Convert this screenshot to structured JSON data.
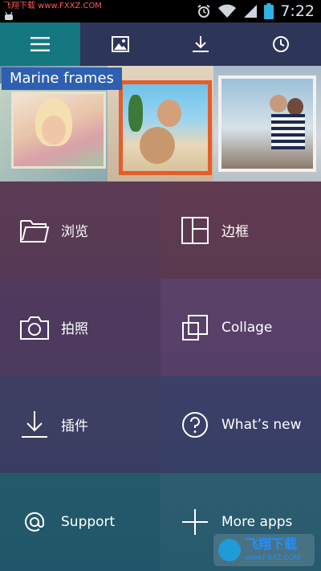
{
  "status_bar": {
    "watermark_text": "飞翔下载 www.FXXZ.COM",
    "time": "7:22",
    "icons": [
      "android-bug-icon",
      "alarm-clock-icon",
      "wifi-icon",
      "signal-icon",
      "battery-icon"
    ]
  },
  "tabs": [
    {
      "icon": "menu-icon",
      "active": true
    },
    {
      "icon": "image-icon",
      "active": false
    },
    {
      "icon": "download-icon",
      "active": false
    },
    {
      "icon": "clock-icon",
      "active": false
    }
  ],
  "banner": {
    "title": "Marine frames"
  },
  "menu": [
    {
      "label": "浏览",
      "icon": "folder-icon",
      "bg": "#5a3a52"
    },
    {
      "label": "边框",
      "icon": "frame-layout-icon",
      "bg": "#5e3a4e"
    },
    {
      "label": "拍照",
      "icon": "camera-icon",
      "bg": "#4f3a5e"
    },
    {
      "label": "Collage",
      "icon": "collage-icon",
      "bg": "#5a4168"
    },
    {
      "label": "插件",
      "icon": "download-icon",
      "bg": "#3d3e63"
    },
    {
      "label": "What’s new",
      "icon": "help-circle-icon",
      "bg": "#3b3f68"
    },
    {
      "label": "Support",
      "icon": "at-sign-icon",
      "bg": "#23596a"
    },
    {
      "label": "More apps",
      "icon": "plus-icon",
      "bg": "#2b5c70"
    }
  ],
  "watermark_badge": {
    "text": "飞翔下载",
    "url": "www.FXXZ.COM"
  }
}
